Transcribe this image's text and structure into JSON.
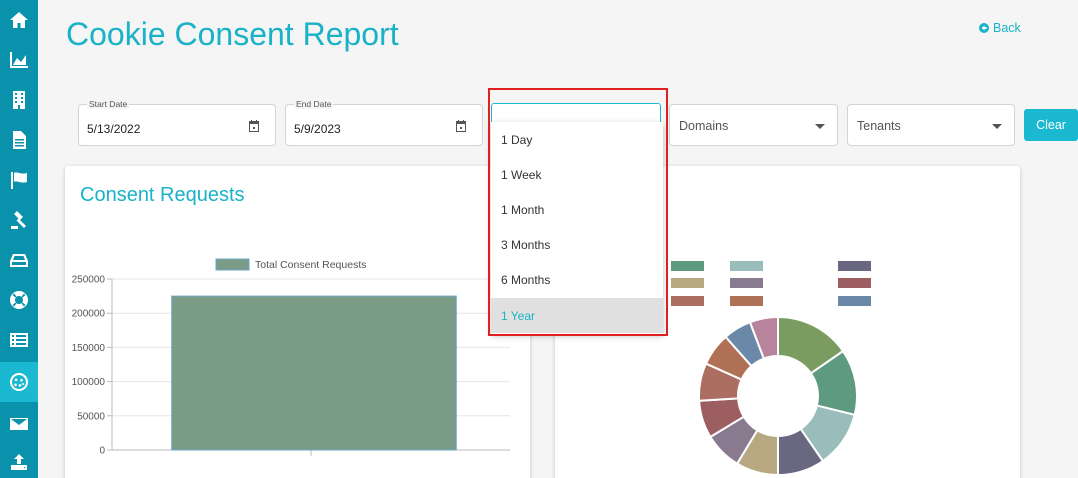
{
  "header": {
    "title": "Cookie Consent Report",
    "back_label": "Back"
  },
  "sidebar": {
    "items": [
      {
        "icon": "home-icon"
      },
      {
        "icon": "area-chart-icon"
      },
      {
        "icon": "building-icon"
      },
      {
        "icon": "document-icon"
      },
      {
        "icon": "flag-icon"
      },
      {
        "icon": "gavel-icon"
      },
      {
        "icon": "drive-icon"
      },
      {
        "icon": "life-ring-icon"
      },
      {
        "icon": "list-icon"
      },
      {
        "icon": "cookie-icon",
        "active": true
      },
      {
        "icon": "envelope-icon"
      },
      {
        "icon": "upload-icon"
      }
    ]
  },
  "filters": {
    "start_date": {
      "label": "Start Date",
      "value": "5/13/2022"
    },
    "end_date": {
      "label": "End Date",
      "value": "5/9/2023"
    },
    "range": {
      "value": ""
    },
    "domains": {
      "placeholder": "Domains"
    },
    "tenants": {
      "placeholder": "Tenants"
    },
    "clear_label": "Clear"
  },
  "dropdown": {
    "options": [
      "1 Day",
      "1 Week",
      "1 Month",
      "3 Months",
      "6 Months",
      "1 Year"
    ],
    "selected": "1 Year"
  },
  "consent_card": {
    "title": "Consent Requests"
  },
  "chart_data": [
    {
      "type": "bar",
      "title": "",
      "legend": [
        "Total Consent Requests"
      ],
      "legend_position": "top",
      "series": [
        {
          "name": "Total Consent Requests",
          "values": [
            225000
          ]
        }
      ],
      "categories": [
        ""
      ],
      "yticks": [
        0,
        50000,
        100000,
        150000,
        200000,
        250000
      ],
      "ylim": [
        0,
        250000
      ],
      "grid": true,
      "colors": [
        "#7a9b86"
      ]
    },
    {
      "type": "pie",
      "title": "",
      "variant": "doughnut",
      "legend_position": "top",
      "values": [
        16,
        14,
        12,
        10,
        9,
        8,
        8,
        8,
        7,
        6,
        6
      ],
      "colors": [
        "#7a9c60",
        "#5e9a80",
        "#98bdbb",
        "#6a6880",
        "#b8a882",
        "#8a7a90",
        "#9c5e60",
        "#ac6e60",
        "#b07055",
        "#6a88a8",
        "#b8849c"
      ]
    }
  ]
}
